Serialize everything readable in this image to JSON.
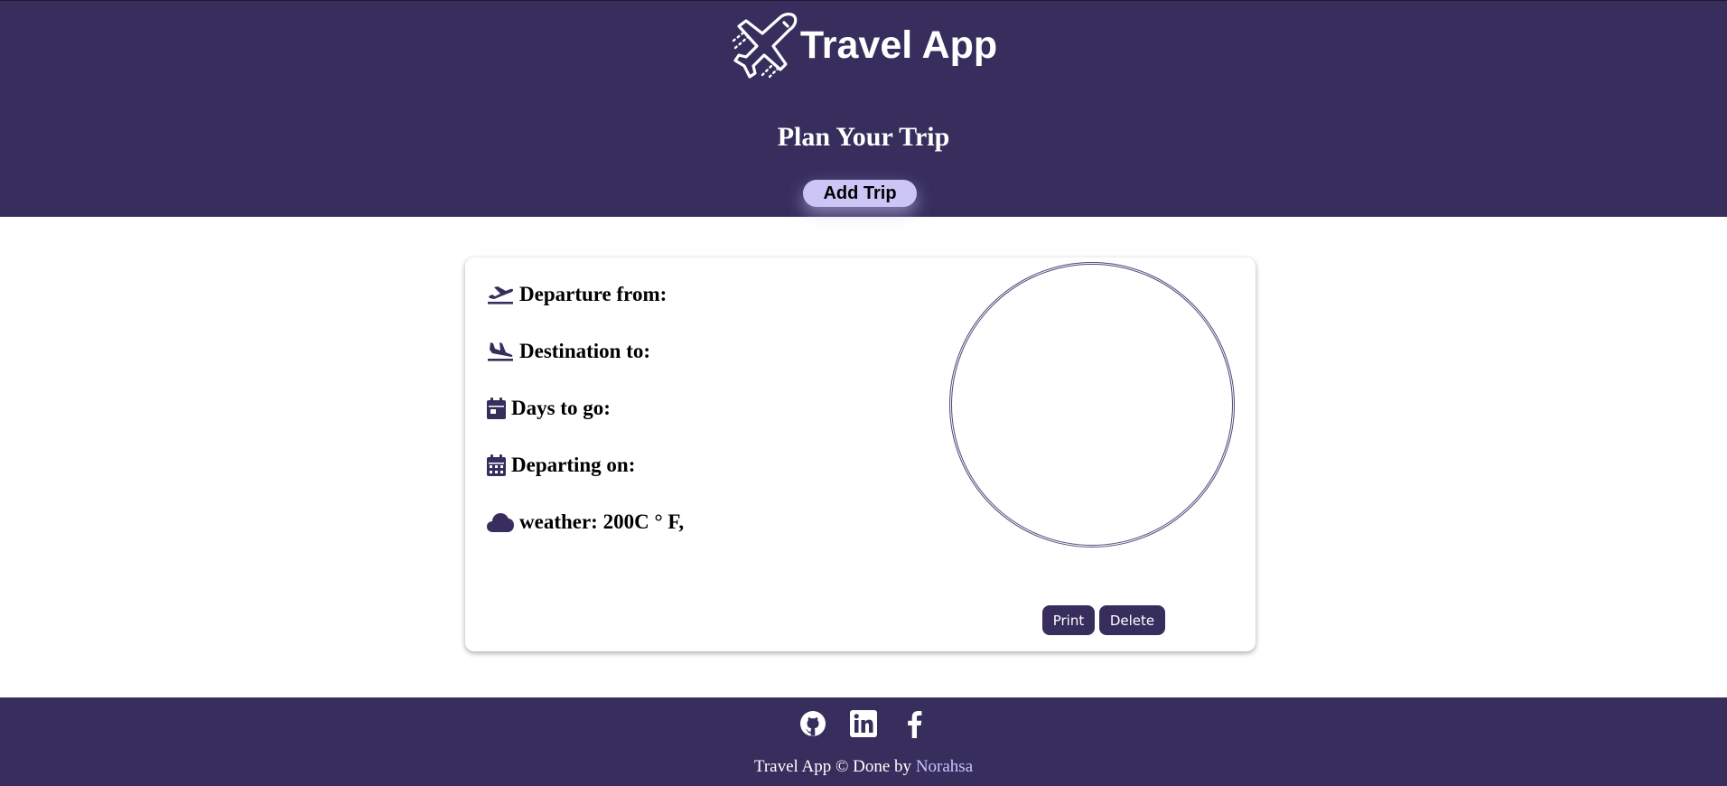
{
  "header": {
    "app_title": "Travel App",
    "logo_icon": "airplane-logo-icon",
    "plan_title": "Plan Your Trip",
    "add_trip_label": "Add Trip"
  },
  "trip_card": {
    "rows": [
      {
        "icon": "plane-departure-icon",
        "label": "Departure from:"
      },
      {
        "icon": "plane-arrival-icon",
        "label": "Destination to:"
      },
      {
        "icon": "calendar-day-icon",
        "label": "Days to go:"
      },
      {
        "icon": "calendar-icon",
        "label": "Departing on:"
      },
      {
        "icon": "cloud-icon",
        "label": "weather: 200C ° F,"
      }
    ],
    "print_label": "Print",
    "delete_label": "Delete"
  },
  "footer": {
    "social_icons": [
      "github-icon",
      "linkedin-icon",
      "facebook-icon"
    ],
    "credit_prefix": "Travel App © Done by ",
    "author_link": "Norahsa"
  },
  "colors": {
    "primary": "#372e5e",
    "accent": "#ccc6f7",
    "link": "#c9c4ff"
  }
}
